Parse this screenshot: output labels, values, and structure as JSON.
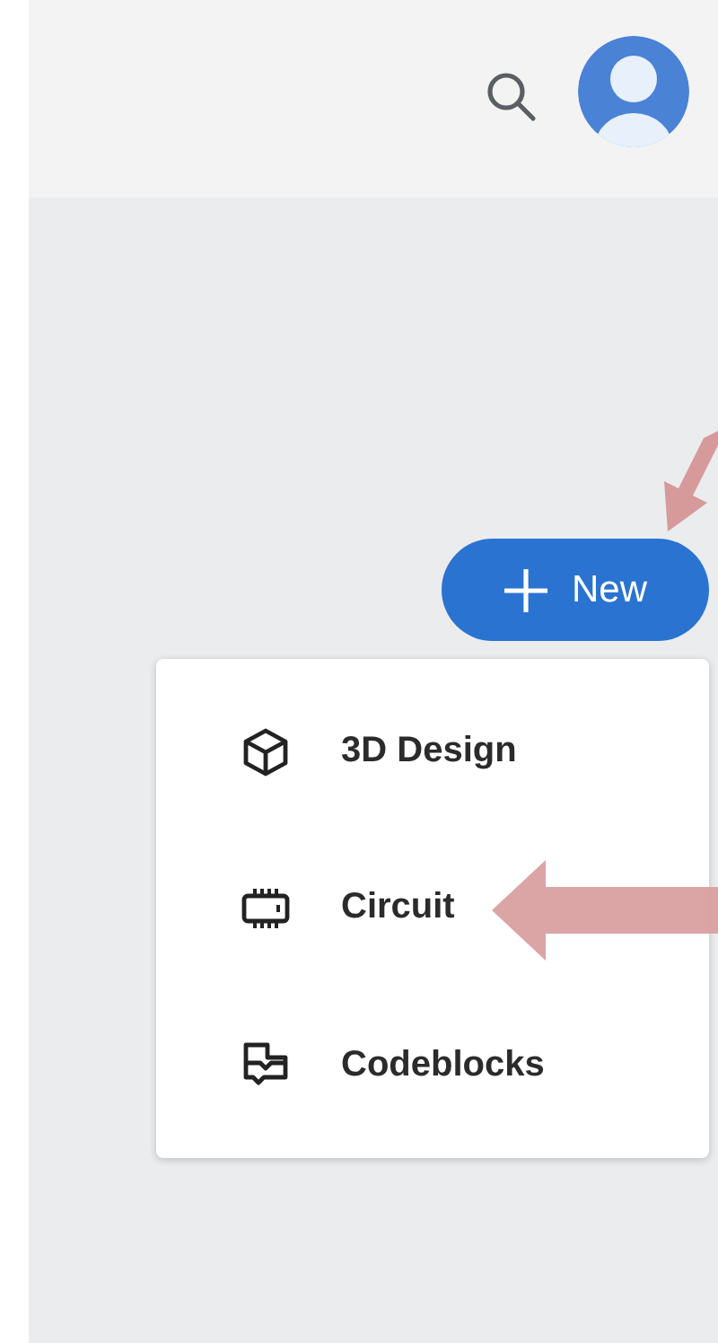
{
  "new_button": {
    "label": "New"
  },
  "menu": {
    "items": [
      {
        "label": "3D Design",
        "kind": "cube"
      },
      {
        "label": "Circuit",
        "kind": "chip"
      },
      {
        "label": "Codeblocks",
        "kind": "blocks"
      }
    ]
  }
}
